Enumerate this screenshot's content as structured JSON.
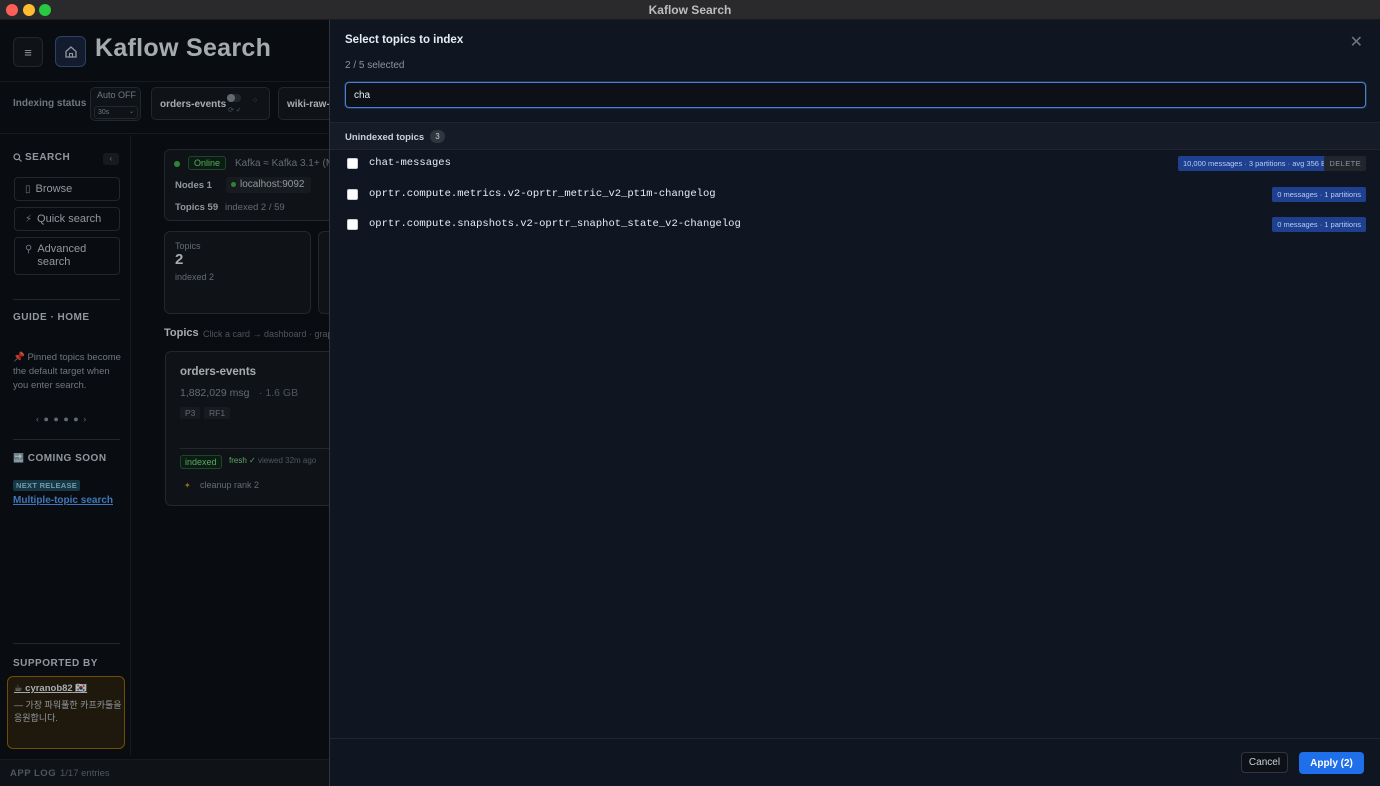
{
  "window": {
    "title": "Kaflow Search"
  },
  "header": {
    "app_title": "Kaflow Search"
  },
  "status_bar": {
    "label": "Indexing status",
    "auto_label": "Auto OFF",
    "interval": "30s",
    "chips": [
      {
        "label": "orders-events",
        "mini": "⟳ ✓",
        "dot": "○"
      },
      {
        "label": "wiki-raw-c"
      }
    ]
  },
  "sidebar": {
    "search_title": "SEARCH",
    "collapse": "‹",
    "nav": [
      {
        "label": "Browse",
        "icon": "▯"
      },
      {
        "label": "Quick search",
        "icon": "⚡"
      },
      {
        "label": "Advanced search",
        "icon": "⚲"
      }
    ],
    "guide_title": "GUIDE · HOME",
    "guide_text": "📌 Pinned topics become the default target when you enter search.",
    "pager": "‹ ● ● ● ● ›",
    "coming_title": "COMING SOON",
    "coming_icon": "🔜",
    "badge": "NEXT RELEASE",
    "coming_link": "Multiple-topic search",
    "supported_title": "SUPPORTED BY",
    "supporter": "cyranob82",
    "supporter_icon": "☕",
    "supporter_flag": "🇰🇷",
    "support_msg": "— 가장 파워풀한 카프카툴을 응원합니다."
  },
  "main": {
    "online": "Online",
    "kafka": "Kafka ≈ Kafka 3.1+ (M",
    "nodes_label": "Nodes 1",
    "host": "localhost:9092",
    "topics_label": "Topics 59",
    "indexed_summary": "indexed 2 / 59",
    "stat": {
      "label": "Topics",
      "value": "2",
      "sub": "indexed 2"
    },
    "topics_heading": "Topics",
    "topics_hint": "Click a card → dashboard · grap",
    "topic_card": {
      "name": "orders-events",
      "msgs": "1,882,029 msg",
      "size": "· 1.6 GB",
      "p": "P3",
      "rf": "RF1",
      "indexed": "indexed",
      "fresh": "fresh ✓",
      "viewed": "viewed 32m ago",
      "cleanup": "cleanup rank 2"
    }
  },
  "app_log": {
    "label": "APP LOG",
    "count": "1/17 entries"
  },
  "modal": {
    "title": "Select topics to index",
    "close": "✕",
    "selected": "2 / 5 selected",
    "search_value": "cha",
    "group_label": "Unindexed topics",
    "group_count": "3",
    "topics": [
      {
        "name": "chat-messages",
        "meta": "10,000 messages · 3 partitions · avg 356 B",
        "action": "DELETE"
      },
      {
        "name": "oprtr.compute.metrics.v2-oprtr_metric_v2_pt1m-changelog",
        "meta": "0 messages · 1 partitions"
      },
      {
        "name": "oprtr.compute.snapshots.v2-oprtr_snaphot_state_v2-changelog",
        "meta": "0 messages · 1 partitions"
      }
    ],
    "cancel": "Cancel",
    "apply": "Apply (2)"
  },
  "colors": {
    "accent": "#1f6feb",
    "online": "#3fb950",
    "support_border": "#9e6a03"
  }
}
